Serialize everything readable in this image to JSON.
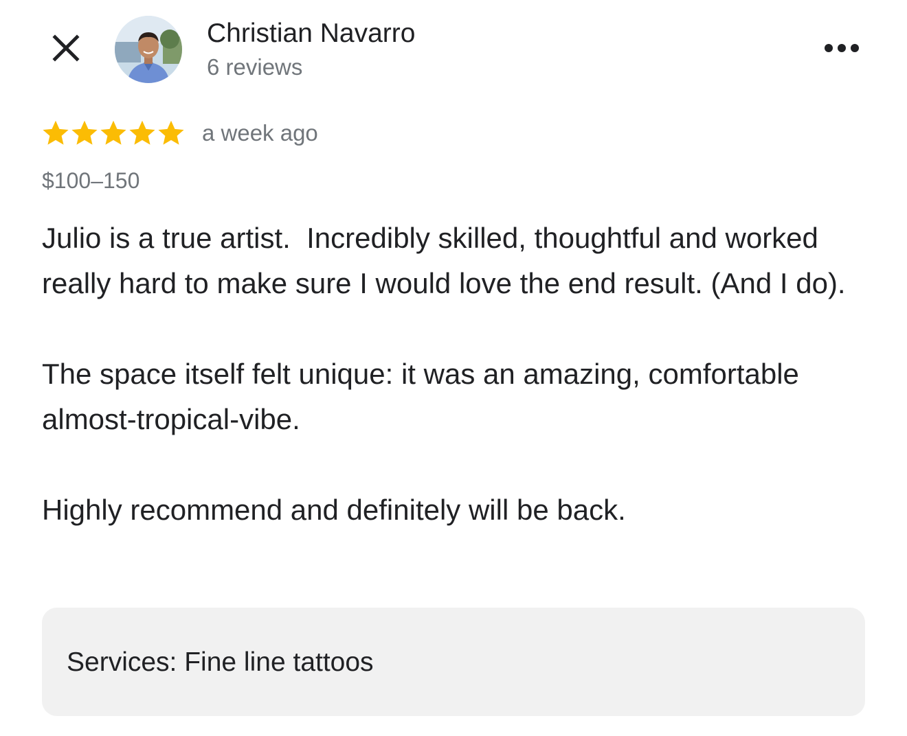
{
  "header": {
    "reviewer_name": "Christian Navarro",
    "review_count": "6 reviews",
    "close_icon": "close-icon",
    "more_icon": "more-horizontal-icon"
  },
  "rating": {
    "stars": 5,
    "max_stars": 5,
    "time_ago": "a week ago",
    "star_color": "#fbbc04"
  },
  "price_range": "$100–150",
  "review": {
    "paragraphs": [
      "Julio is a true artist.  Incredibly skilled, thoughtful and worked really hard to make sure I would love the end result. (And I do).",
      "The space itself felt unique: it was an amazing, comfortable almost-tropical-vibe.",
      "Highly recommend and definitely will be back."
    ]
  },
  "services": {
    "label": "Services:",
    "value": "Fine line tattoos"
  },
  "colors": {
    "primary_text": "#202124",
    "secondary_text": "#70757a",
    "services_bg": "#f1f1f1"
  }
}
